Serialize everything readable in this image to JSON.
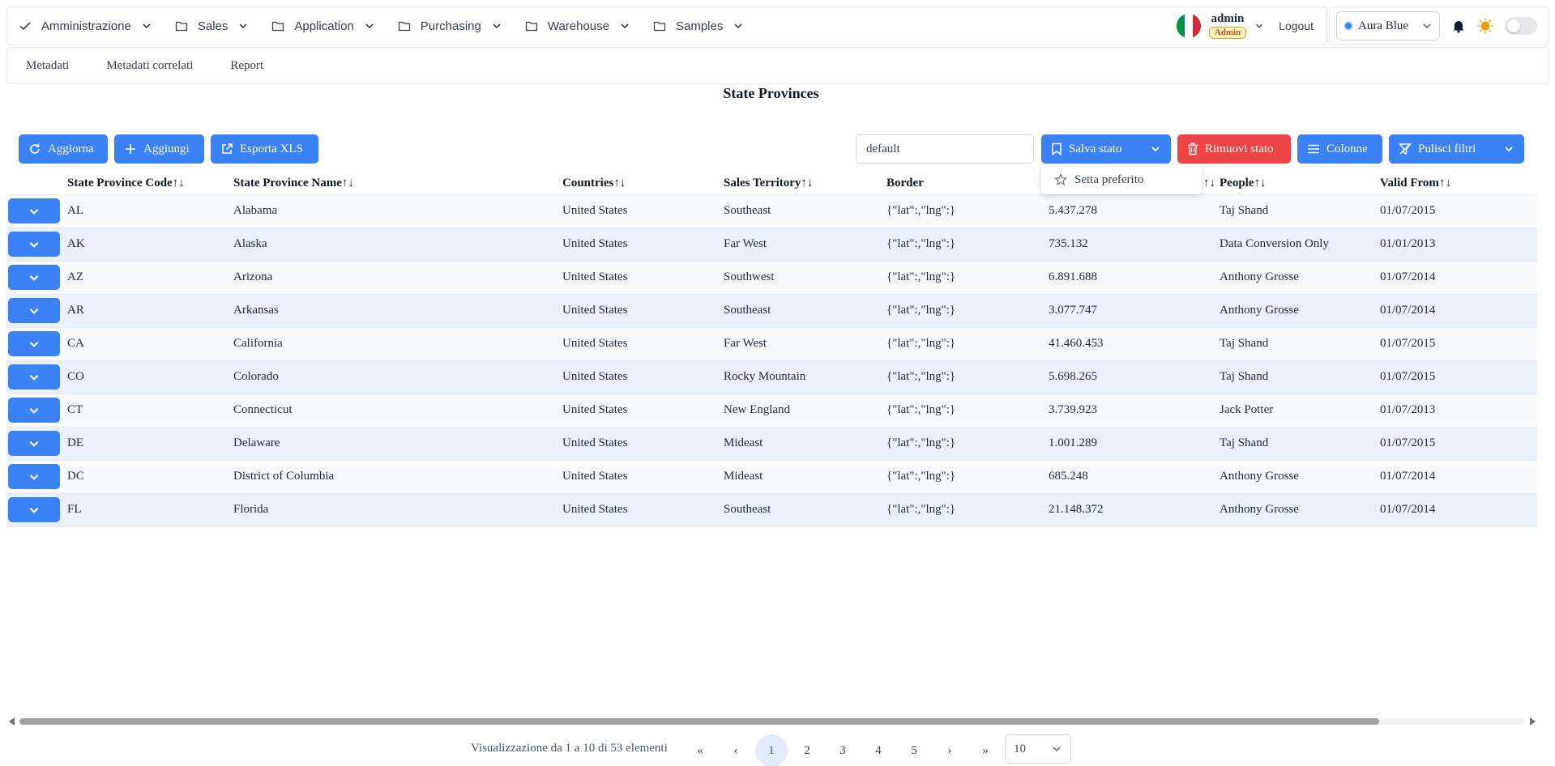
{
  "nav": {
    "menus": [
      {
        "label": "Amministrazione",
        "icon": "check-icon"
      },
      {
        "label": "Sales",
        "icon": "folder-icon"
      },
      {
        "label": "Application",
        "icon": "folder-icon"
      },
      {
        "label": "Purchasing",
        "icon": "folder-icon"
      },
      {
        "label": "Warehouse",
        "icon": "folder-icon"
      },
      {
        "label": "Samples",
        "icon": "folder-icon"
      }
    ],
    "user": {
      "name": "admin",
      "role": "Admin"
    },
    "logout_label": "Logout",
    "theme_select": "Aura Blue"
  },
  "subnav": {
    "items": [
      "Metadati",
      "Metadati correlati",
      "Report"
    ]
  },
  "page": {
    "title": "State Provinces"
  },
  "toolbar": {
    "refresh_label": "Aggiorna",
    "add_label": "Aggiungi",
    "export_label": "Esporta XLS",
    "state_input_value": "default",
    "save_state_label": "Salva stato",
    "remove_state_label": "Rimuovi stato",
    "columns_label": "Colonne",
    "clear_filters_label": "Pulisci filtri"
  },
  "dropdown": {
    "item_label": "Setta preferito"
  },
  "table": {
    "columns": [
      {
        "label": "State Province Code",
        "sort": "↑↓"
      },
      {
        "label": "State Province Name",
        "sort": "↑↓"
      },
      {
        "label": "Countries",
        "sort": "↑↓"
      },
      {
        "label": "Sales Territory",
        "sort": "↑↓"
      },
      {
        "label": "Border",
        "sort": ""
      },
      {
        "label": "",
        "sort": "↑↓"
      },
      {
        "label": "People",
        "sort": "↑↓"
      },
      {
        "label": "Valid From",
        "sort": "↑↓"
      }
    ],
    "rows": [
      [
        "AL",
        "Alabama",
        "United States",
        "Southeast",
        "{\"lat\":,\"lng\":}",
        "5.437.278",
        "Taj Shand",
        "01/07/2015"
      ],
      [
        "AK",
        "Alaska",
        "United States",
        "Far West",
        "{\"lat\":,\"lng\":}",
        "735.132",
        "Data Conversion Only",
        "01/01/2013"
      ],
      [
        "AZ",
        "Arizona",
        "United States",
        "Southwest",
        "{\"lat\":,\"lng\":}",
        "6.891.688",
        "Anthony Grosse",
        "01/07/2014"
      ],
      [
        "AR",
        "Arkansas",
        "United States",
        "Southeast",
        "{\"lat\":,\"lng\":}",
        "3.077.747",
        "Anthony Grosse",
        "01/07/2014"
      ],
      [
        "CA",
        "California",
        "United States",
        "Far West",
        "{\"lat\":,\"lng\":}",
        "41.460.453",
        "Taj Shand",
        "01/07/2015"
      ],
      [
        "CO",
        "Colorado",
        "United States",
        "Rocky Mountain",
        "{\"lat\":,\"lng\":}",
        "5.698.265",
        "Taj Shand",
        "01/07/2015"
      ],
      [
        "CT",
        "Connecticut",
        "United States",
        "New England",
        "{\"lat\":,\"lng\":}",
        "3.739.923",
        "Jack Potter",
        "01/07/2013"
      ],
      [
        "DE",
        "Delaware",
        "United States",
        "Mideast",
        "{\"lat\":,\"lng\":}",
        "1.001.289",
        "Taj Shand",
        "01/07/2015"
      ],
      [
        "DC",
        "District of Columbia",
        "United States",
        "Mideast",
        "{\"lat\":,\"lng\":}",
        "685.248",
        "Anthony Grosse",
        "01/07/2014"
      ],
      [
        "FL",
        "Florida",
        "United States",
        "Southeast",
        "{\"lat\":,\"lng\":}",
        "21.148.372",
        "Anthony Grosse",
        "01/07/2014"
      ]
    ]
  },
  "paginator": {
    "info": "Visualizzazione da 1 a 10 di 53 elementi",
    "first": "«",
    "prev": "‹",
    "pages": [
      "1",
      "2",
      "3",
      "4",
      "5"
    ],
    "active_page": "1",
    "next": "›",
    "last": "»",
    "rows_per_page": "10"
  },
  "colors": {
    "primary": "#3b82f6",
    "danger": "#ef4444",
    "row_alt": "#eaf1fb"
  }
}
